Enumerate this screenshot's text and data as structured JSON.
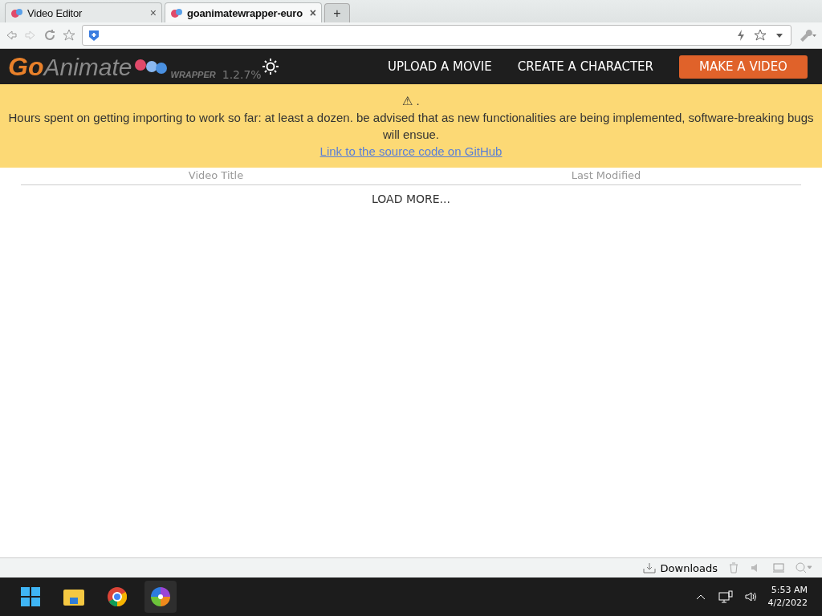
{
  "browser": {
    "tabs": [
      {
        "title": "Video Editor",
        "selected": false
      },
      {
        "title": "goanimatewrapper-euro",
        "selected": true
      }
    ],
    "new_tab": "+",
    "close": "×"
  },
  "site_header": {
    "logo_go": "Go",
    "logo_animate": "Animate",
    "logo_sub": "WRAPPER",
    "version": "1.2.7%",
    "nav": [
      {
        "label": "UPLOAD A MOVIE",
        "kind": "link"
      },
      {
        "label": "CREATE A CHARACTER",
        "kind": "link"
      },
      {
        "label": "MAKE A VIDEO",
        "kind": "button"
      }
    ]
  },
  "banner": {
    "icon": "⚠",
    "title": ".",
    "message": "Hours spent on getting importing to work so far: at least a dozen. be advised that as new functionalities are being implemented, software-breaking bugs will ensue.",
    "link": "Link to the source code on GitHub"
  },
  "table": {
    "columns": [
      "Video Title",
      "Last Modified"
    ],
    "load_more": "LOAD MORE..."
  },
  "status_bar": {
    "downloads": "Downloads"
  },
  "taskbar": {
    "time": "5:53 AM",
    "date": "4/2/2022"
  }
}
